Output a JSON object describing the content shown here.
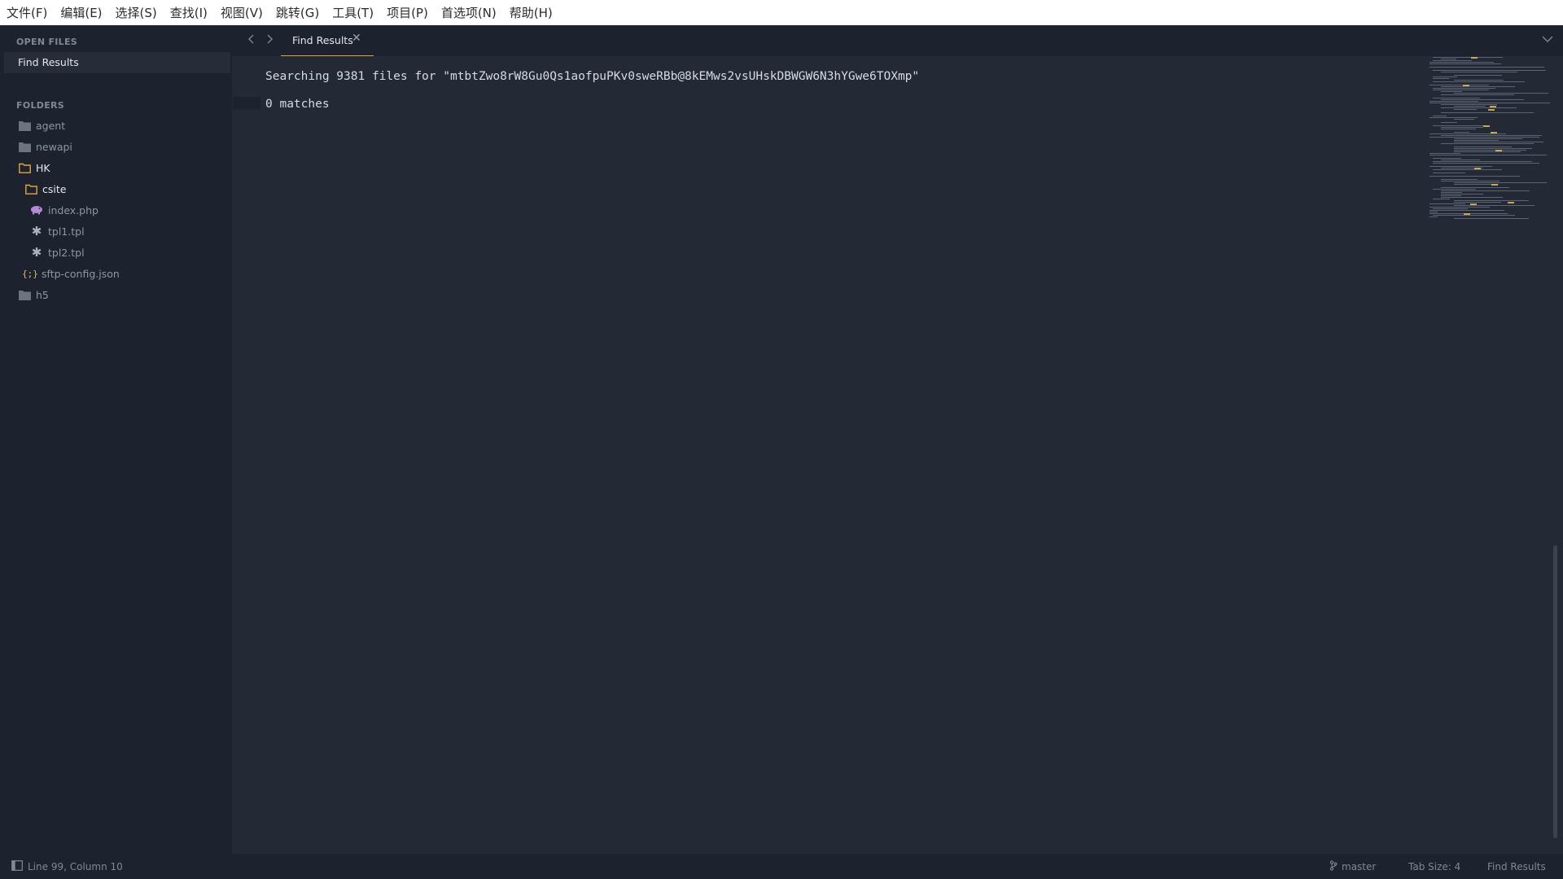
{
  "menubar": {
    "items": [
      "文件(F)",
      "编辑(E)",
      "选择(S)",
      "查找(I)",
      "视图(V)",
      "跳转(G)",
      "工具(T)",
      "项目(P)",
      "首选项(N)",
      "帮助(H)"
    ]
  },
  "sidebar": {
    "open_files_heading": "OPEN FILES",
    "open_files": [
      "Find Results"
    ],
    "folders_heading": "FOLDERS",
    "tree": [
      {
        "label": "agent",
        "icon": "folder-icon",
        "state": "closed"
      },
      {
        "label": "newapi",
        "icon": "folder-icon",
        "state": "closed"
      },
      {
        "label": "HK",
        "icon": "folder-open-icon",
        "state": "open"
      },
      {
        "label": "csite",
        "icon": "folder-open-icon",
        "state": "open"
      },
      {
        "label": "index.php",
        "icon": "php-elephant-icon",
        "state": "file"
      },
      {
        "label": "tpl1.tpl",
        "icon": "asterisk-icon",
        "state": "file"
      },
      {
        "label": "tpl2.tpl",
        "icon": "asterisk-icon",
        "state": "file"
      },
      {
        "label": "sftp-config.json",
        "icon": "json-braces-icon",
        "state": "file"
      },
      {
        "label": "h5",
        "icon": "folder-icon",
        "state": "closed"
      }
    ]
  },
  "tabs": {
    "active_label": "Find Results",
    "close_glyph": "✕"
  },
  "editor": {
    "search_line": "Searching 9381 files for \"mtbtZwo8rW8Gu0Qs1aofpuPKv0sweRBb@8kEMws2vsUHskDBWGW6N3hYGwe6TOXmp\"",
    "matches_line": "0 matches"
  },
  "statusbar": {
    "position": "Line 99, Column 10",
    "branch": "master",
    "tab_size": "Tab Size: 4",
    "syntax": "Find Results"
  },
  "colors": {
    "accent": "#e2a53c",
    "folder_open": "#e2a53c",
    "background": "#232a36",
    "sidebar": "#1d232e"
  }
}
